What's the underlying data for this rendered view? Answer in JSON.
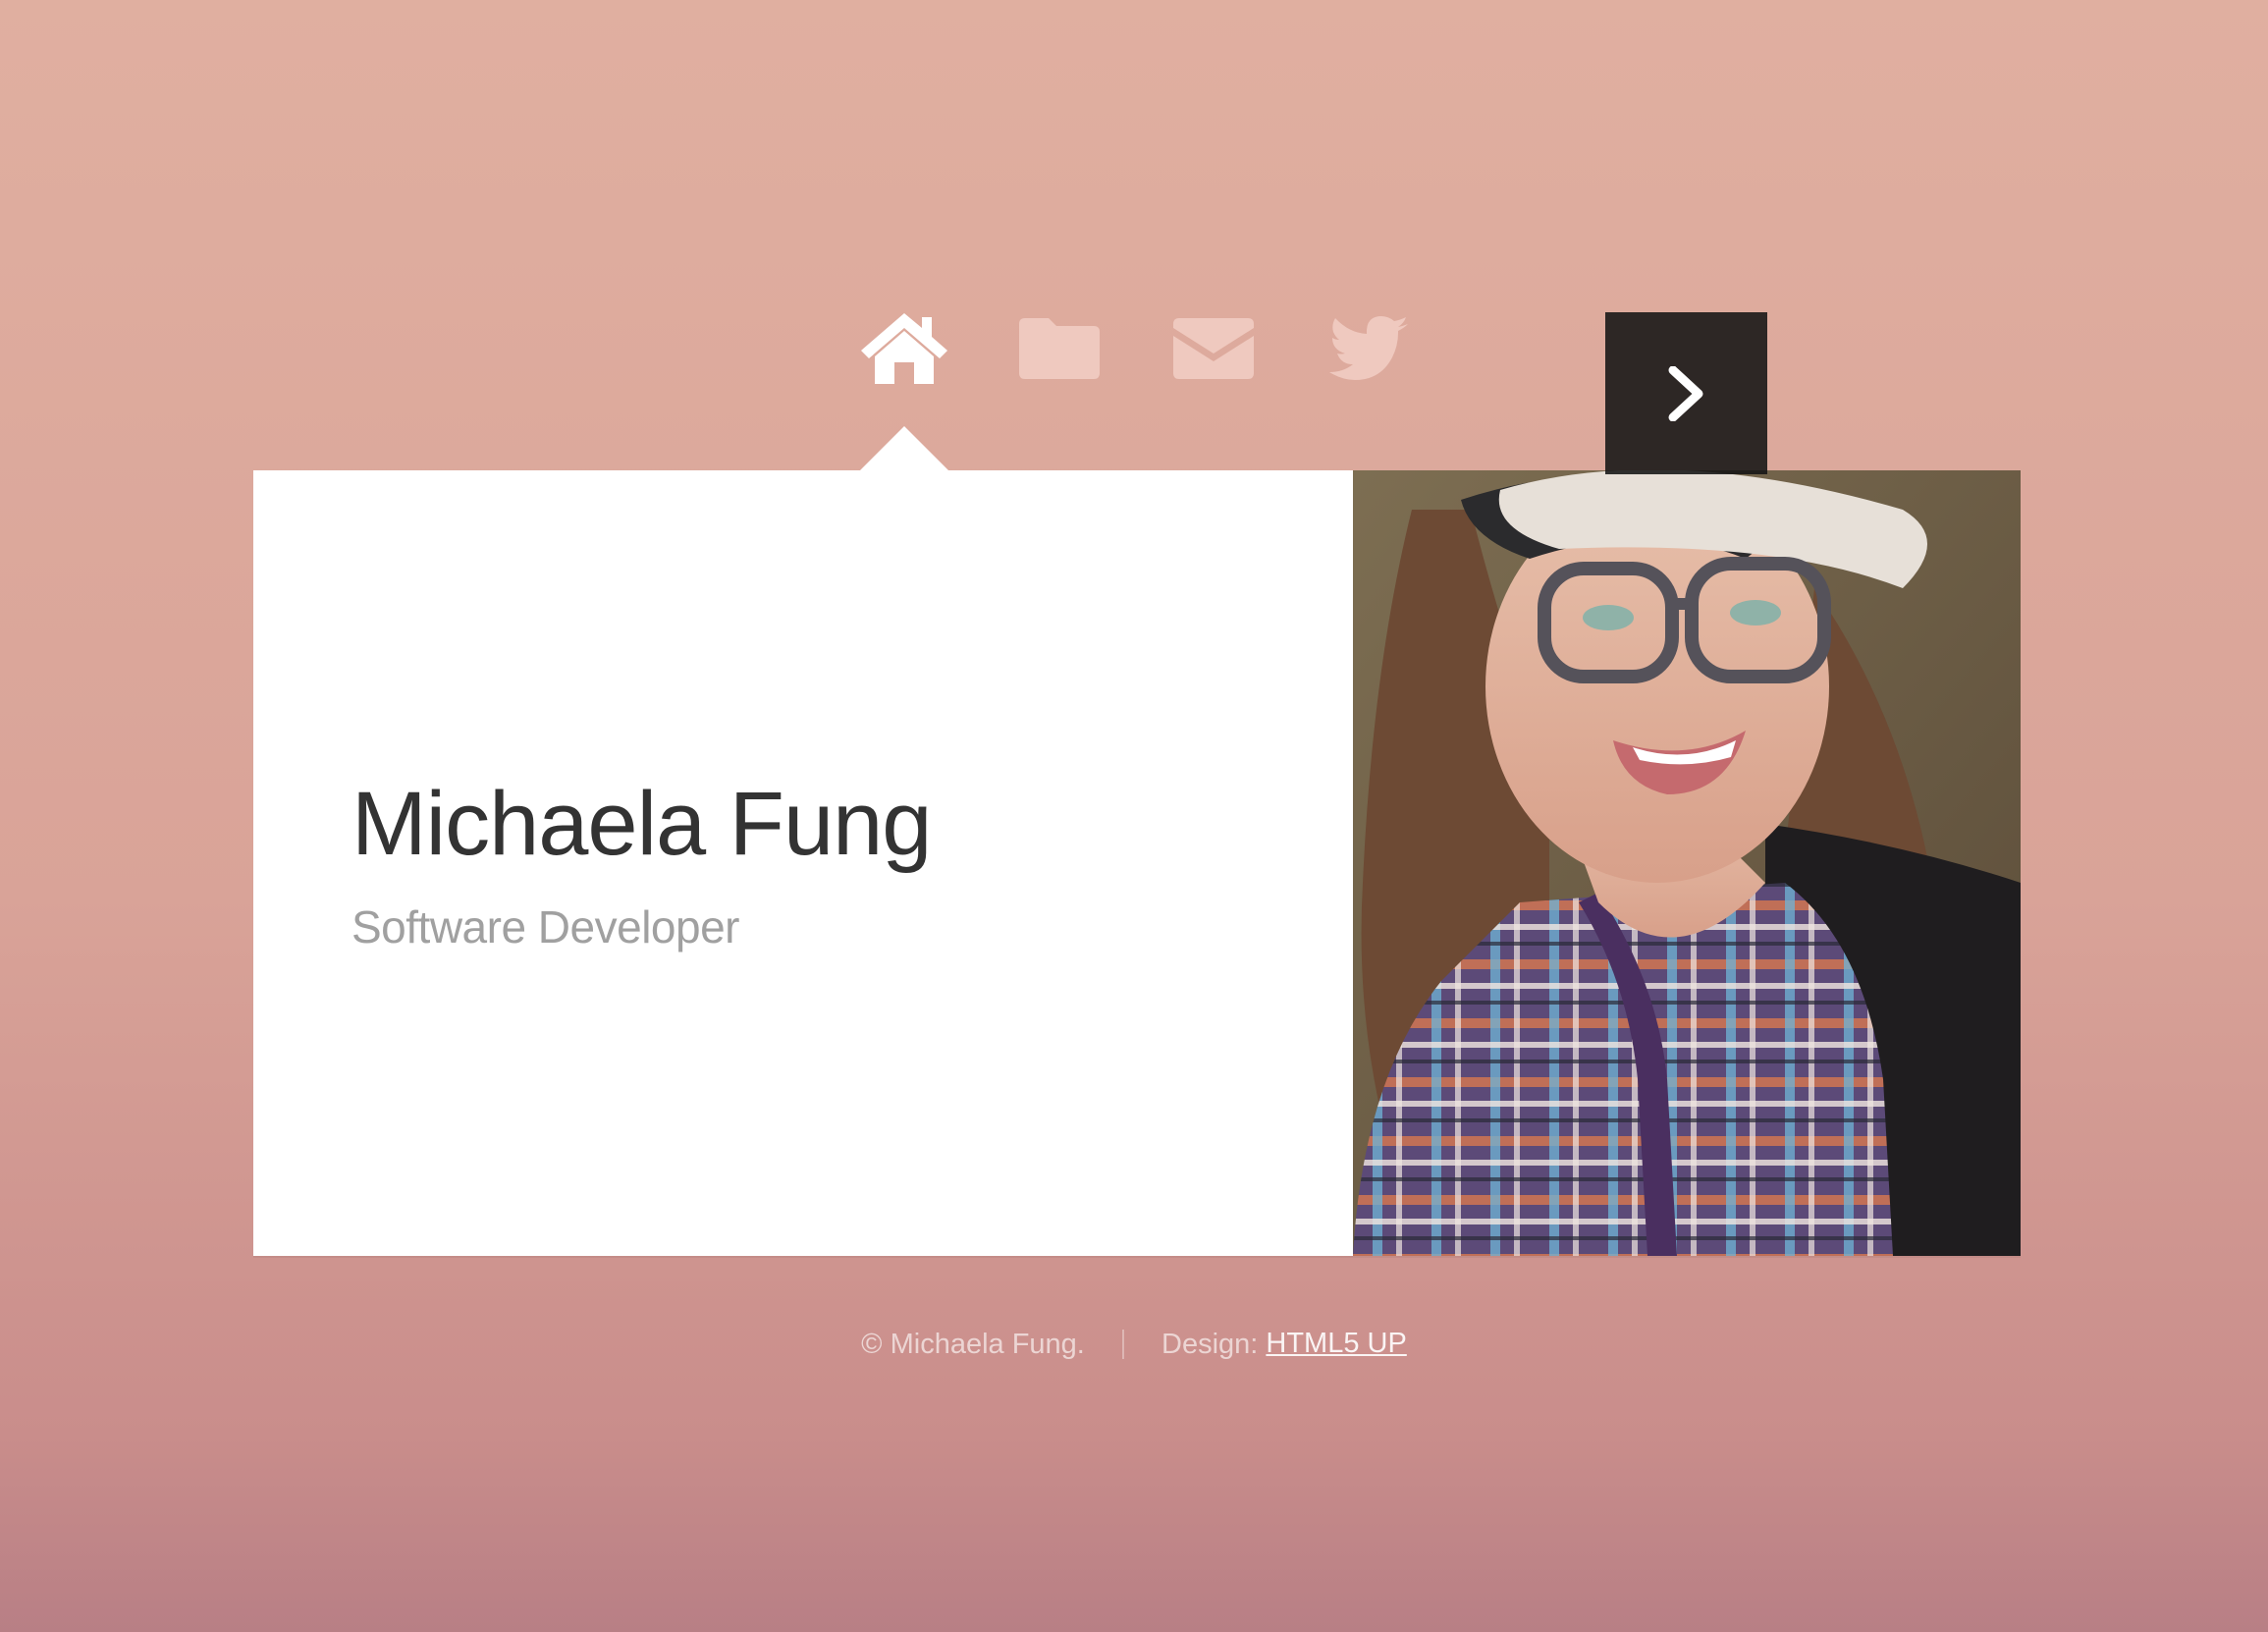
{
  "nav": {
    "items": [
      {
        "icon": "home-icon",
        "active": true
      },
      {
        "icon": "folder-icon",
        "active": false
      },
      {
        "icon": "envelope-icon",
        "active": false
      },
      {
        "icon": "twitter-icon",
        "active": false
      }
    ]
  },
  "profile": {
    "name": "Michaela Fung",
    "role": "Software Developer",
    "photo_icon": "portrait-photo",
    "next_icon": "chevron-right-icon"
  },
  "footer": {
    "copyright": "© Michaela Fung.",
    "design_label": "Design:",
    "design_link": "HTML5 UP"
  },
  "colors": {
    "background": "#dca99c",
    "card": "#ffffff",
    "name_text": "#333333",
    "role_text": "#a0a0a0",
    "nav_active": "#ffffff",
    "nav_inactive": "#efc9bf"
  }
}
